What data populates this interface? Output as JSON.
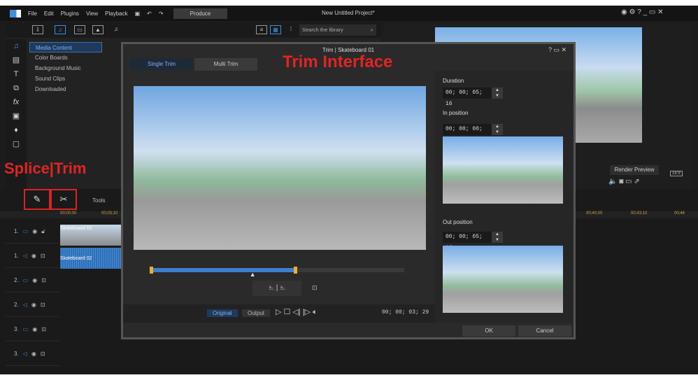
{
  "menu": {
    "items": [
      "File",
      "Edit",
      "Plugins",
      "View",
      "Playback"
    ],
    "produce": "Produce",
    "project_title": "New Untitled Project*"
  },
  "library": {
    "search_placeholder": "Search the library",
    "categories": [
      "Media Content",
      "Color Boards",
      "Background Music",
      "Sound Clips",
      "Downloaded"
    ]
  },
  "preview": {
    "render_label": "Render Preview",
    "aspect": "16:9"
  },
  "annotations": {
    "splice_trim": "Splice|Trim",
    "trim_interface": "Trim Interface"
  },
  "timeline": {
    "tools_label": "Tools",
    "ruler": [
      "00;00;00",
      "00;03;10",
      "00;40;00",
      "00;43;10",
      "00;46"
    ],
    "tracks": [
      "1.",
      "1.",
      "2.",
      "2.",
      "3.",
      "3."
    ],
    "clips": [
      "Skateboard 02",
      "Skateboard 02"
    ]
  },
  "dialog": {
    "title": "Trim | Skateboard 01",
    "tabs": [
      "Single Trim",
      "Multi Trim"
    ],
    "duration_label": "Duration",
    "duration": "00; 00; 05; 16",
    "in_label": "In position",
    "in_value": "00; 00; 00; 00",
    "out_label": "Out position",
    "out_value": "00; 00; 05; 16",
    "original": "Original",
    "output": "Output",
    "current_time": "00; 00; 03; 29",
    "ok": "OK",
    "cancel": "Cancel",
    "trim_fraction_start": 0.0,
    "trim_fraction_end": 0.57,
    "playhead_fraction": 0.4
  }
}
